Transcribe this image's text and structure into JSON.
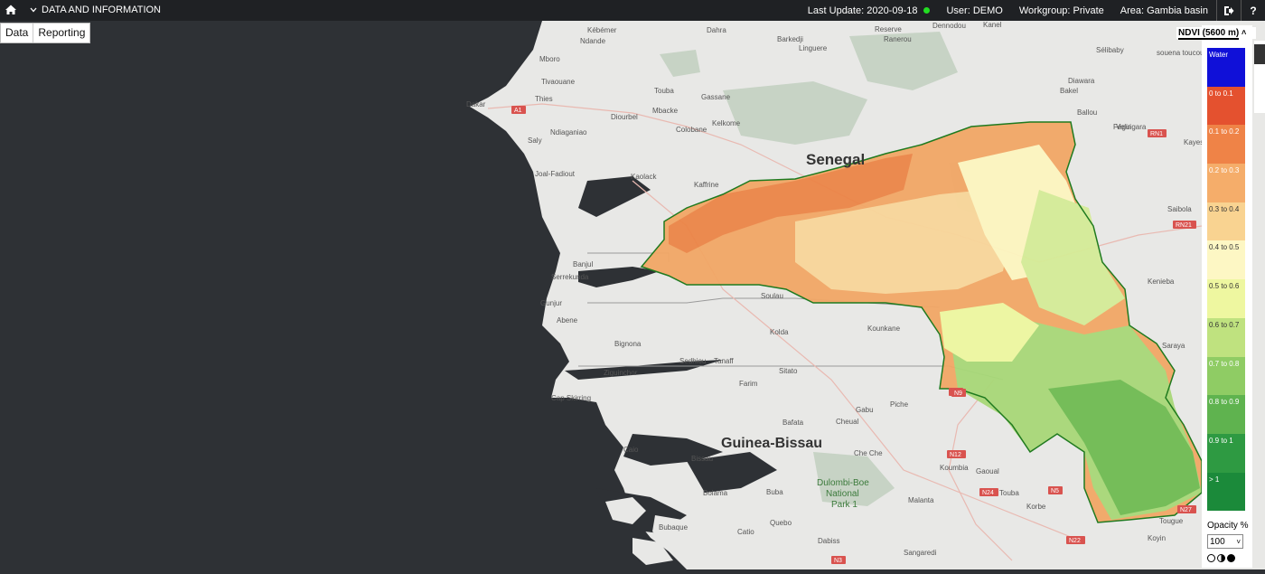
{
  "topbar": {
    "home_icon": "home-icon",
    "menu_label": "DATA AND INFORMATION",
    "last_update": "Last Update: 2020-09-18",
    "status_color": "#22dd22",
    "user": "User: DEMO",
    "workgroup": "Workgroup: Private",
    "area": "Area: Gambia basin",
    "logout_icon": "logout-icon",
    "help_label": "?"
  },
  "tabs": {
    "data": "Data",
    "reporting": "Reporting"
  },
  "map": {
    "country_senegal": "Senegal",
    "country_guinea_bissau": "Guinea-Bissau",
    "park": [
      "Dulombi-Boe",
      "National",
      "Park 1"
    ],
    "places": [
      "Dakar",
      "Thies",
      "Tivaouane",
      "Touba",
      "Diourbel",
      "Mbacke",
      "Gassane",
      "Kelkome",
      "Colobane",
      "Ndiaganiao",
      "Kaolack",
      "Kaffrine",
      "Banjul",
      "Serrekunda",
      "Soulau",
      "Kolda",
      "Kounkane",
      "Sedhiou",
      "Tanaff",
      "Ziguinchor",
      "Bignona",
      "Sitato",
      "Farim",
      "Bafata",
      "Gabu",
      "Piche",
      "Cheual",
      "Che Che",
      "Bissau",
      "Buba",
      "Quebo",
      "Catio",
      "Bubaque",
      "Dabiss",
      "Sangaredi",
      "Koumbia",
      "Gaoual",
      "Touba",
      "Korbe",
      "Malanta",
      "Koyin",
      "Tougue",
      "Saraya",
      "Kenieba",
      "Saibola",
      "Sélibaby",
      "Bakel",
      "Diawara",
      "Ballou",
      "Velingara",
      "Linguere",
      "Kébémer",
      "Ndande",
      "Dahra",
      "Barkedji",
      "Reserve",
      "Ranerou",
      "Dennodou",
      "Kanel",
      "Fégui",
      "Joal-Fadiout",
      "Abene",
      "Cap Skirring",
      "Gunjur",
      "Mboro",
      "Saly",
      "Caio",
      "Bolama",
      "Kayes",
      "souena toucouleur"
    ],
    "road_labels": [
      "A1",
      "N1",
      "N9",
      "N12",
      "N24",
      "N5",
      "N22",
      "N27",
      "N3",
      "RN1",
      "RN21"
    ]
  },
  "legend": {
    "title": "NDVI (5600 m)",
    "collapse_icon": "chevron-up-icon",
    "classes": [
      {
        "label": "Water",
        "color": "#1010d8"
      },
      {
        "label": "0 to 0.1",
        "color": "#e4512f"
      },
      {
        "label": "0.1 to 0.2",
        "color": "#ef8347"
      },
      {
        "label": "0.2 to 0.3",
        "color": "#f5ad6a"
      },
      {
        "label": "0.3 to 0.4",
        "color": "#f9d391"
      },
      {
        "label": "0.4 to 0.5",
        "color": "#fdf7c4"
      },
      {
        "label": "0.5 to 0.6",
        "color": "#eef7a0"
      },
      {
        "label": "0.6 to 0.7",
        "color": "#bfe27f"
      },
      {
        "label": "0.7 to 0.8",
        "color": "#8fcc64"
      },
      {
        "label": "0.8 to 0.9",
        "color": "#5fb34f"
      },
      {
        "label": "0.9 to 1",
        "color": "#2e9a42"
      },
      {
        "label": "> 1",
        "color": "#1b8a3a"
      }
    ],
    "opacity_label": "Opacity %",
    "opacity_value": "100"
  }
}
